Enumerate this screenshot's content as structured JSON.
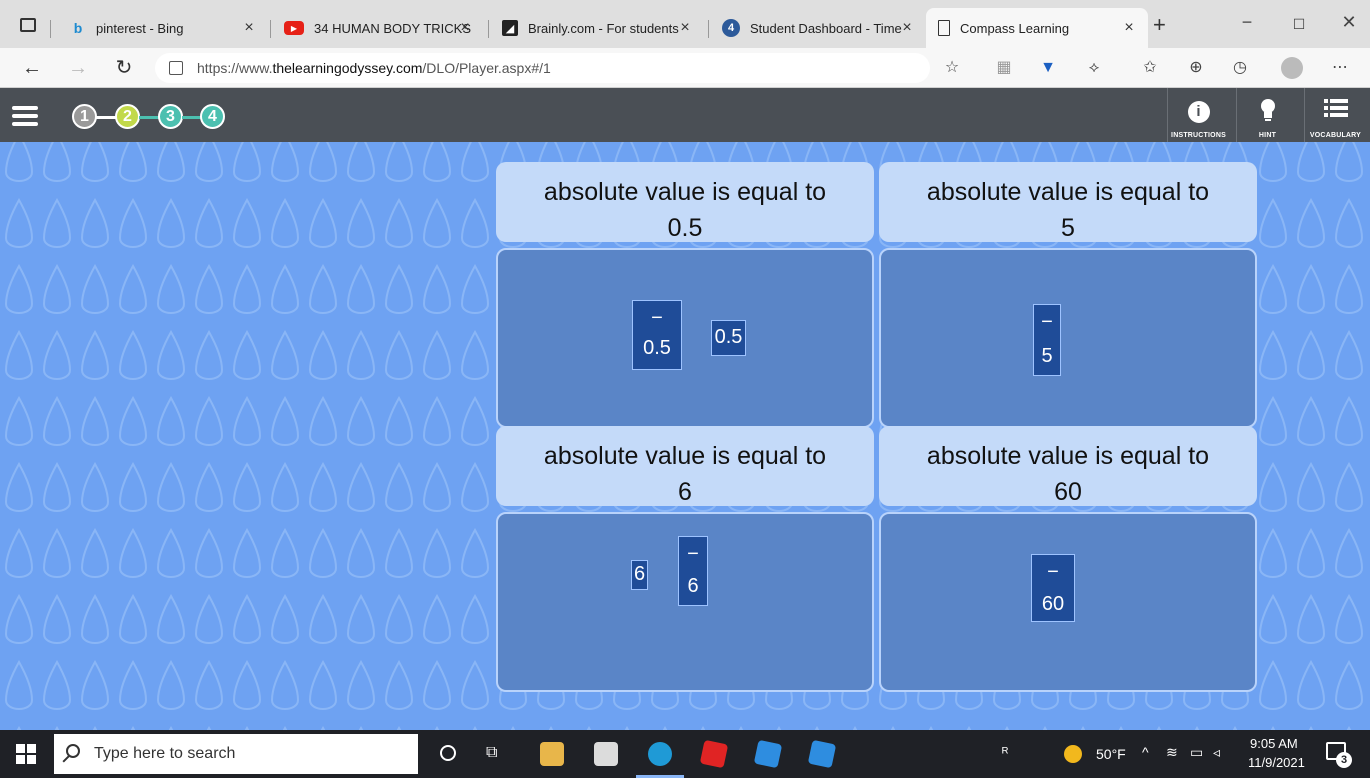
{
  "browser": {
    "tabs": [
      {
        "title": "pinterest - Bing",
        "favicon": "bing-icon",
        "color": "#1e8bd0"
      },
      {
        "title": "34 HUMAN BODY TRICKS",
        "favicon": "youtube-icon",
        "color": "#e62117"
      },
      {
        "title": "Brainly.com - For students",
        "favicon": "brainly-icon",
        "color": "#222222"
      },
      {
        "title": "Student Dashboard - Time",
        "favicon": "dashboard-icon",
        "color": "#2d5a9a"
      },
      {
        "title": "Compass Learning",
        "favicon": "page-icon",
        "color": "#ffffff"
      }
    ],
    "new_tab_label": "+",
    "url": {
      "prefix": "https://www.",
      "domain": "thelearningodyssey.com",
      "path": "/DLO/Player.aspx#/1"
    }
  },
  "app": {
    "steps": [
      {
        "label": "1",
        "color": "#9a9a9a"
      },
      {
        "label": "2",
        "color": "#c2d94a"
      },
      {
        "label": "3",
        "color": "#4cc0b0"
      },
      {
        "label": "4",
        "color": "#4cc0b0"
      }
    ],
    "buttons": {
      "instructions": "INSTRUCTIONS",
      "hint": "HINT",
      "vocabulary": "VOCABULARY"
    }
  },
  "cards": [
    {
      "line1": "absolute value is equal to",
      "line2": "0.5"
    },
    {
      "line1": "absolute value is equal to",
      "line2": "5"
    },
    {
      "line1": "absolute value is equal to",
      "line2": "6"
    },
    {
      "line1": "absolute value is equal to",
      "line2": "60"
    }
  ],
  "tiles": {
    "neg_05": {
      "sign": "−",
      "value": "0.5"
    },
    "pos_05": {
      "value": "0.5"
    },
    "neg_5": {
      "sign": "−",
      "value": "5"
    },
    "pos_6": {
      "value": "6"
    },
    "neg_6": {
      "sign": "−",
      "value": "6"
    },
    "neg_60": {
      "sign": "−",
      "value": "60"
    }
  },
  "taskbar": {
    "search_placeholder": "Type here to search",
    "temperature": "50°F",
    "time": "9:05 AM",
    "date": "11/9/2021",
    "notifications": "3"
  }
}
